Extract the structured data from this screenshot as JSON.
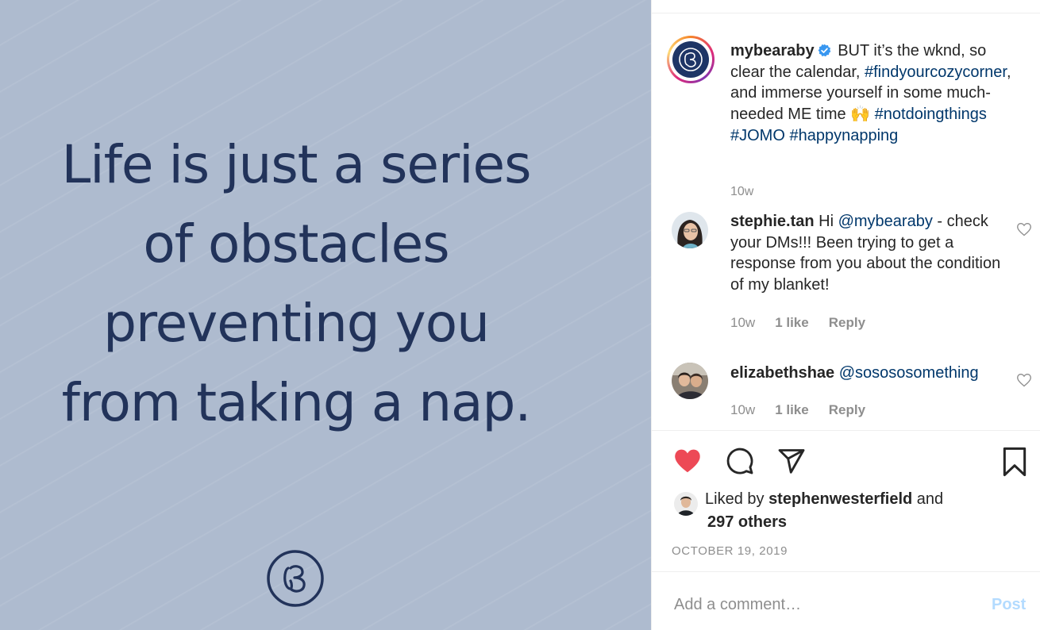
{
  "image": {
    "quote_lines": [
      "Life is just a series",
      "of obstacles",
      "preventing you",
      "from taking a nap."
    ],
    "background_color": "#aebbcf",
    "text_color": "#22335a",
    "brand_icon": "bearaby-b-logo"
  },
  "post": {
    "author": "mybearaby",
    "verified_icon": "verified-badge-icon",
    "caption": {
      "text_1": "BUT it’s the wknd, so clear the calendar, ",
      "tag_1": "#findyourcozycorner",
      "text_2": ", and immerse yourself in some much-needed ME time 🙌 ",
      "tag_2": "#notdoingthings",
      "tag_3": "#JOMO",
      "tag_4": "#happynapping"
    },
    "age": "10w"
  },
  "comments": [
    {
      "user": "stephie.tan",
      "text_before": "Hi ",
      "mention": "@mybearaby",
      "text_after": " - check your DMs!!! Been trying to get a response from you about the condition of my blanket!",
      "age": "10w",
      "likes": "1 like",
      "reply": "Reply"
    },
    {
      "user": "elizabethshae",
      "mention": "@sosososomething",
      "age": "10w",
      "likes": "1 like",
      "reply": "Reply"
    }
  ],
  "actions": {
    "like_icon": "heart-filled-icon",
    "comment_icon": "comment-bubble-icon",
    "share_icon": "paper-plane-icon",
    "save_icon": "bookmark-icon",
    "like_color": "#ed4956"
  },
  "likes": {
    "prefix": "Liked by",
    "user": "stephenwesterfield",
    "and": "and",
    "others": "297 others"
  },
  "date": "OCTOBER 19, 2019",
  "comment_box": {
    "placeholder": "Add a comment…",
    "post_label": "Post"
  }
}
